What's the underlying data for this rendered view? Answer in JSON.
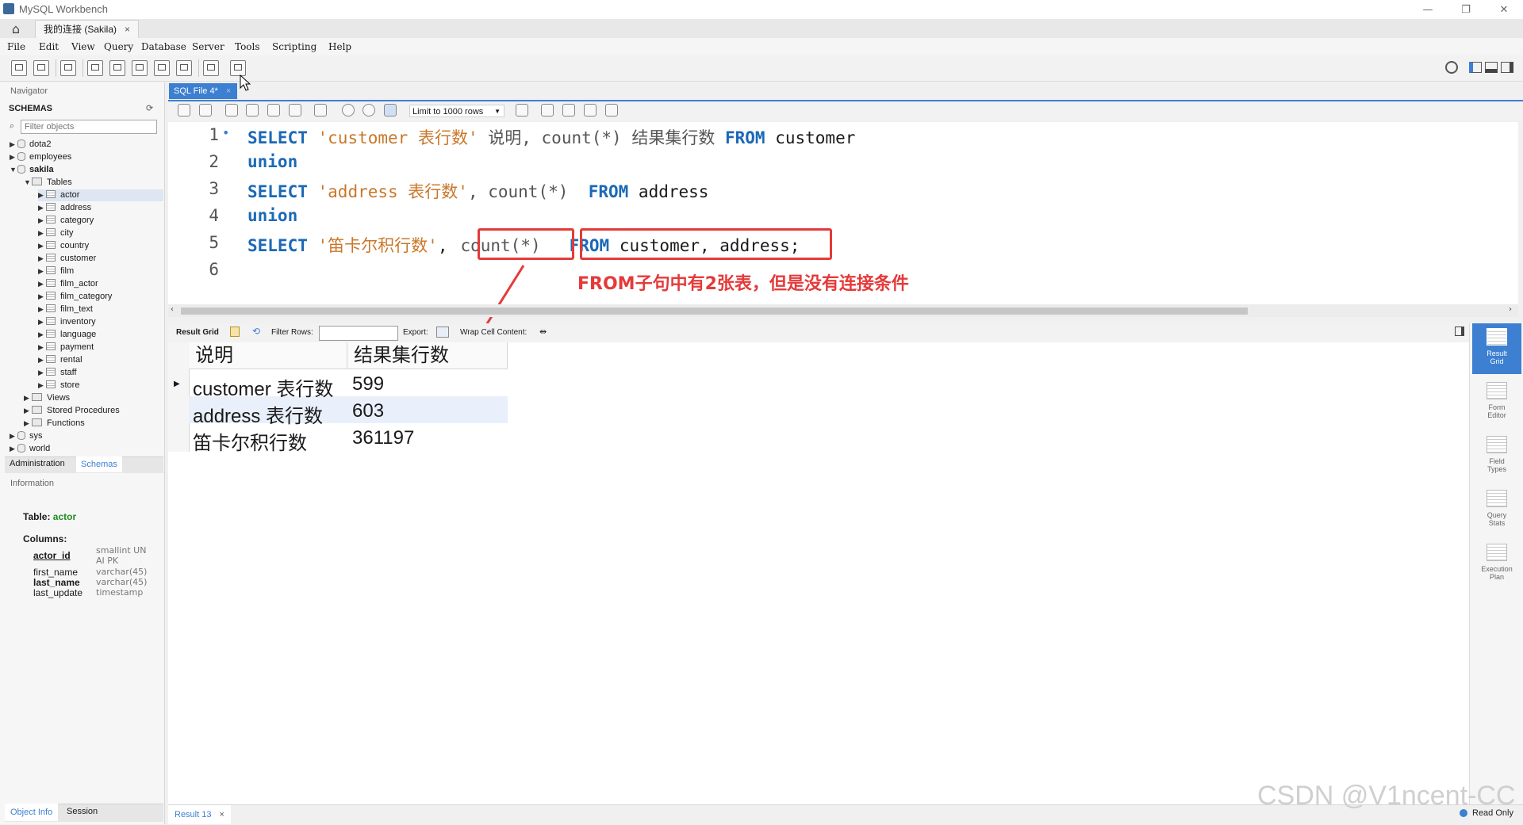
{
  "window": {
    "title": "MySQL Workbench",
    "minimize": "—",
    "restore": "❐",
    "close": "✕"
  },
  "connection_tab": {
    "label": "我的连接 (Sakila)",
    "close": "×"
  },
  "menu": [
    "File",
    "Edit",
    "View",
    "Query",
    "Database",
    "Server",
    "Tools",
    "Scripting",
    "Help"
  ],
  "navigator": {
    "header": "Navigator",
    "schemas_label": "SCHEMAS",
    "filter_placeholder": "Filter objects",
    "schemas": [
      "dota2",
      "employees",
      "sakila",
      "sys",
      "world"
    ],
    "tables_label": "Tables",
    "tables": [
      "actor",
      "address",
      "category",
      "city",
      "country",
      "customer",
      "film",
      "film_actor",
      "film_category",
      "film_text",
      "inventory",
      "language",
      "payment",
      "rental",
      "staff",
      "store"
    ],
    "views_label": "Views",
    "procedures_label": "Stored Procedures",
    "functions_label": "Functions"
  },
  "sidebar_tabs": {
    "admin": "Administration",
    "schemas": "Schemas"
  },
  "information": {
    "header": "Information",
    "table_label": "Table:",
    "table_name": "actor",
    "columns_label": "Columns:",
    "columns": [
      {
        "name": "actor_id",
        "type": "smallint UN",
        "type2": "AI PK"
      },
      {
        "name": "first_name",
        "type": "varchar(45)"
      },
      {
        "name": "last_name",
        "type": "varchar(45)"
      },
      {
        "name": "last_update",
        "type": "timestamp"
      }
    ]
  },
  "bottom_tabs": {
    "object_info": "Object Info",
    "session": "Session"
  },
  "editor": {
    "tab_label": "SQL File 4*",
    "tab_close": "×",
    "limit": "Limit to 1000 rows",
    "line_numbers": [
      "1",
      "2",
      "3",
      "4",
      "5",
      "6"
    ],
    "line1_marker": "•",
    "lines": {
      "l1_kw1": "SELECT",
      "l1_str": "'customer 表行数'",
      "l1_rest": "说明, count(*) 结果集行数",
      "l1_kw2": "FROM",
      "l1_tbl": "customer",
      "l2_kw": "union",
      "l3_kw1": "SELECT",
      "l3_str": "'address 表行数'",
      "l3_rest": ", count(*)",
      "l3_kw2": "FROM",
      "l3_tbl": "address",
      "l4_kw": "union",
      "l5_kw1": "SELECT",
      "l5_str": "'笛卡尔积行数'",
      "l5_comma": ",",
      "l5_count": "count(*)",
      "l5_kw2": "FROM",
      "l5_tbl": "customer, address;"
    },
    "annotation": "FROM子句中有2张表，但是没有连接条件"
  },
  "result_toolbar": {
    "result_grid": "Result Grid",
    "filter_rows": "Filter Rows:",
    "export": "Export:",
    "wrap": "Wrap Cell Content:"
  },
  "result": {
    "columns": [
      "说明",
      "结果集行数"
    ],
    "rows": [
      [
        "customer 表行数",
        "599"
      ],
      [
        "address 表行数",
        "603"
      ],
      [
        "笛卡尔积行数",
        "361197"
      ]
    ]
  },
  "right_panel": [
    {
      "line1": "Result",
      "line2": "Grid"
    },
    {
      "line1": "Form",
      "line2": "Editor"
    },
    {
      "line1": "Field",
      "line2": "Types"
    },
    {
      "line1": "Query",
      "line2": "Stats"
    },
    {
      "line1": "Execution",
      "line2": "Plan"
    }
  ],
  "bottom": {
    "result_tab": "Result 13",
    "result_tab_close": "×",
    "status": "Read Only",
    "watermark": "CSDN @V1ncent-CC"
  },
  "colors": {
    "keyword": "#1b69b6",
    "string": "#c9772a",
    "highlight": "#e53a3a",
    "accent": "#3d7fd1"
  }
}
